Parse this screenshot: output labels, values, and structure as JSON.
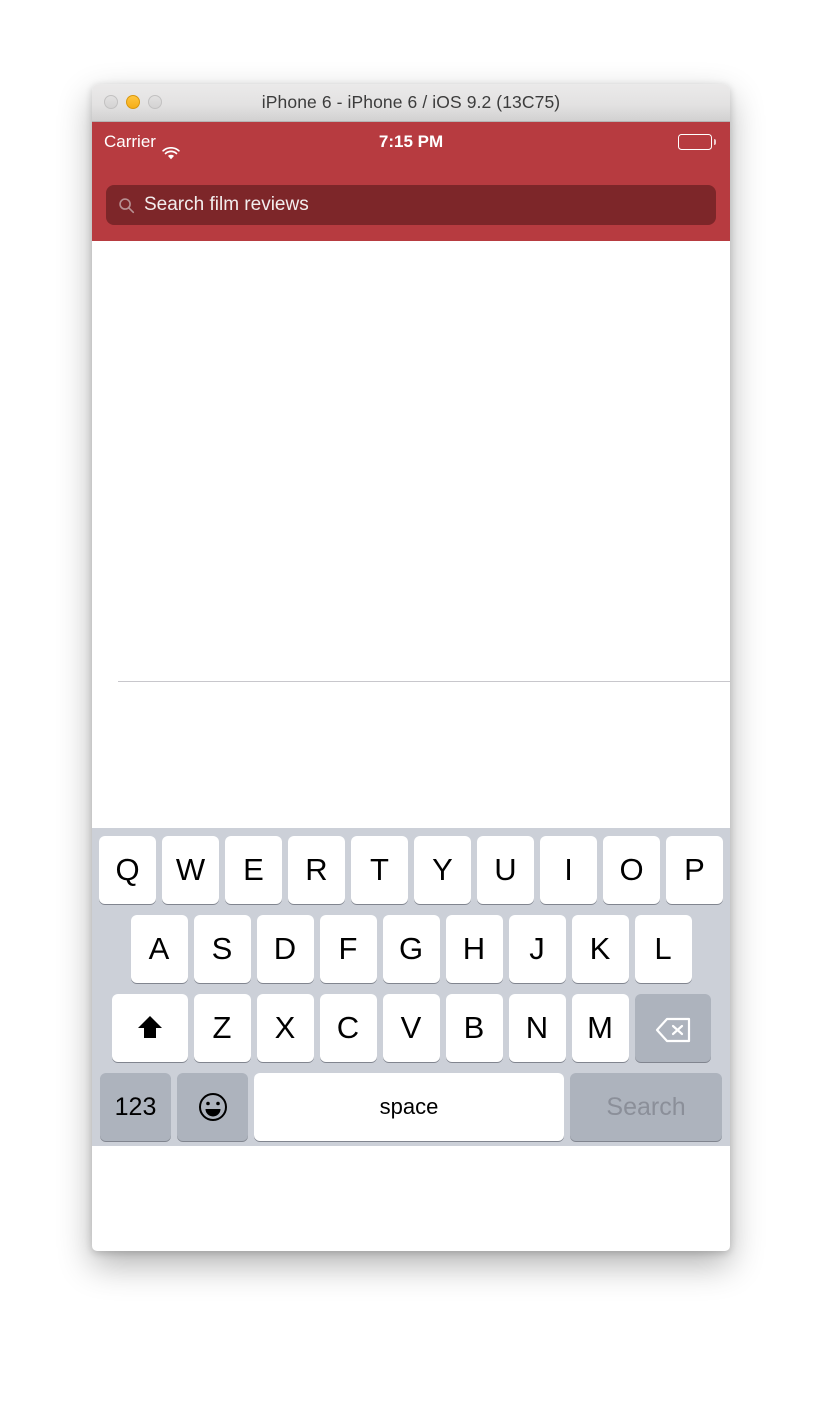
{
  "window": {
    "title": "iPhone 6 - iPhone 6 / iOS 9.2 (13C75)",
    "traffic_lights": [
      {
        "name": "close",
        "state": "disabled",
        "color": "#dcdbdb"
      },
      {
        "name": "minimize",
        "state": "active",
        "color": "#f5ae18"
      },
      {
        "name": "zoom",
        "state": "disabled",
        "color": "#dcdbdb"
      }
    ]
  },
  "status_bar": {
    "carrier": "Carrier",
    "wifi_icon": "wifi-icon",
    "time": "7:15 PM",
    "battery_icon": "battery-full-icon"
  },
  "search": {
    "icon": "search-icon",
    "placeholder": "Search film reviews",
    "value": ""
  },
  "colors": {
    "nav_bar_red": "#b73b40",
    "search_field_red": "#7d2629",
    "keyboard_background": "#ccd0d8",
    "key_white": "#ffffff",
    "key_gray": "#adb3bd",
    "separator": "#c8c7cc",
    "return_key_text": "#8b8f99"
  },
  "keyboard": {
    "row1": [
      "Q",
      "W",
      "E",
      "R",
      "T",
      "Y",
      "U",
      "I",
      "O",
      "P"
    ],
    "row2": [
      "A",
      "S",
      "D",
      "F",
      "G",
      "H",
      "J",
      "K",
      "L"
    ],
    "row3_letters": [
      "Z",
      "X",
      "C",
      "V",
      "B",
      "N",
      "M"
    ],
    "shift_icon": "shift-icon",
    "delete_icon": "delete-icon",
    "numbers_label": "123",
    "emoji_icon": "emoji-icon",
    "space_label": "space",
    "return_label": "Search"
  }
}
